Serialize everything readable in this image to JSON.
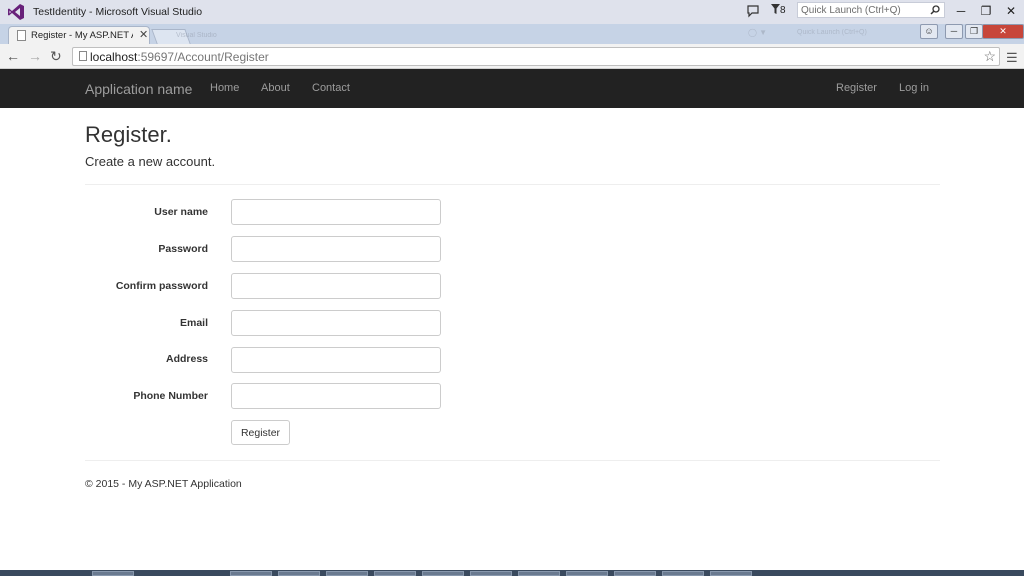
{
  "vs": {
    "title": "TestIdentity - Microsoft Visual Studio",
    "notification_count": "8",
    "quick_launch_placeholder": "Quick Launch (Ctrl+Q)"
  },
  "browser": {
    "tab_title": "Register - My ASP.NET Ap",
    "url_host": "localhost",
    "url_rest": ":59697/Account/Register",
    "ghost_tab_text": "Visual Studio",
    "ghost_quick_text": "Quick Launch (Ctrl+Q)"
  },
  "navbar": {
    "brand": "Application name",
    "links": [
      "Home",
      "About",
      "Contact"
    ],
    "right_links": [
      "Register",
      "Log in"
    ]
  },
  "page": {
    "title": "Register.",
    "subtitle": "Create a new account."
  },
  "form": {
    "fields": [
      {
        "label": "User name",
        "value": ""
      },
      {
        "label": "Password",
        "value": ""
      },
      {
        "label": "Confirm password",
        "value": ""
      },
      {
        "label": "Email",
        "value": ""
      },
      {
        "label": "Address",
        "value": ""
      },
      {
        "label": "Phone Number",
        "value": ""
      }
    ],
    "submit_label": "Register"
  },
  "footer": {
    "text": "© 2015 - My ASP.NET Application"
  },
  "colors": {
    "navbar_bg": "#222222",
    "nav_text": "#9d9d9d",
    "vs_purple": "#68217a"
  },
  "icons": [
    "visual-studio-logo-icon",
    "feedback-icon",
    "filter-icon",
    "search-icon",
    "minimize-icon",
    "restore-icon",
    "close-icon",
    "back-arrow-icon",
    "forward-arrow-icon",
    "reload-icon",
    "page-icon",
    "star-icon",
    "menu-icon"
  ]
}
